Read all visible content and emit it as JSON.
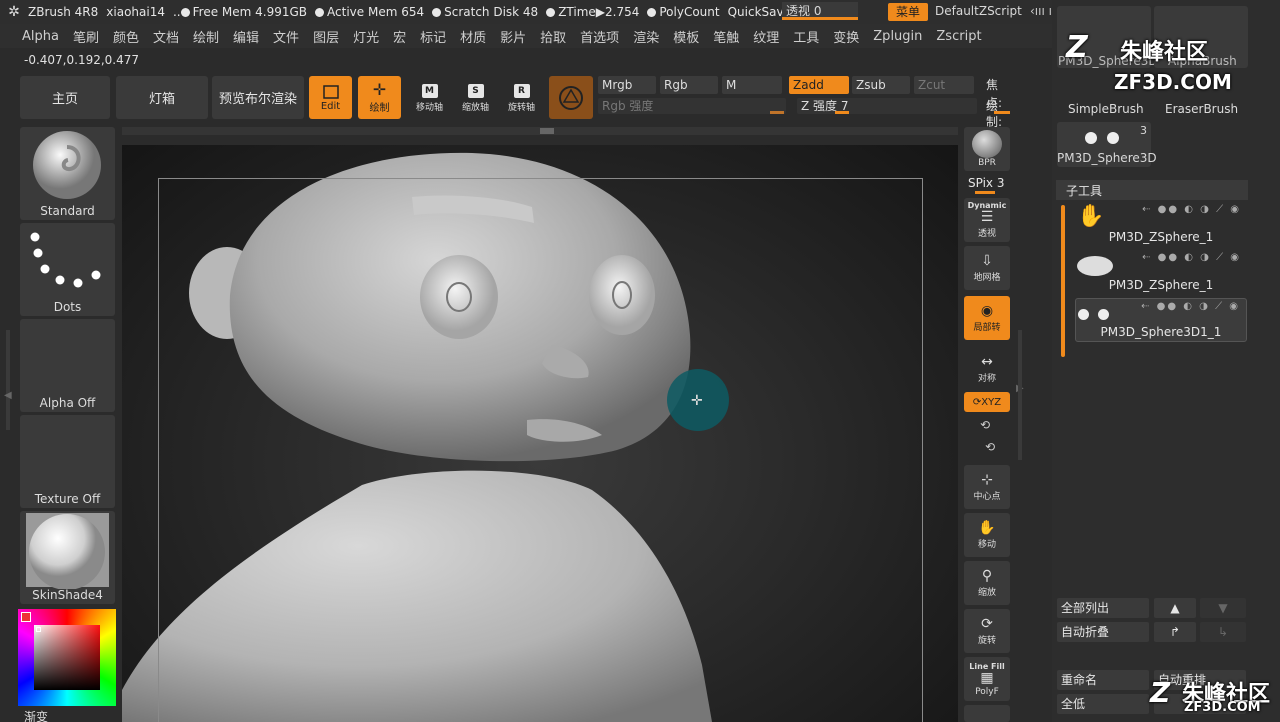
{
  "titlebar": {
    "app": "ZBrush 4R8",
    "user": "xiaohai14",
    "free_mem": "Free Mem 4.991GB",
    "active_mem": "Active Mem 654",
    "scratch_disk": "Scratch Disk 48",
    "ztime": "ZTime▶2.754",
    "polycount": "PolyCount",
    "quicksave": "QuickSave",
    "toushi_label": "透视",
    "toushi_value": "0",
    "menu_label": "菜单",
    "default_zscript": "DefaultZScript"
  },
  "menubar": [
    "Alpha",
    "笔刷",
    "颜色",
    "文档",
    "绘制",
    "编辑",
    "文件",
    "图层",
    "灯光",
    "宏",
    "标记",
    "材质",
    "影片",
    "拾取",
    "首选项",
    "渲染",
    "模板",
    "笔触",
    "纹理",
    "工具",
    "变换",
    "Zplugin",
    "Zscript"
  ],
  "coords": "-0.407,0.192,0.477",
  "toolbar": {
    "home": "主页",
    "lightbox": "灯箱",
    "bool_preview": "预览布尔渲染",
    "edit": "Edit",
    "draw": "绘制",
    "move": "移动轴",
    "scale": "缩放轴",
    "rotate": "旋转轴",
    "mrgb": "Mrgb",
    "rgb": "Rgb",
    "m": "M",
    "zadd": "Zadd",
    "zsub": "Zsub",
    "zcut": "Zcut",
    "focal": "焦点:",
    "rgb_intensity": "Rgb 强度",
    "z_intensity_label": "Z 强度",
    "z_intensity_value": "7",
    "draw_size": "绘制:"
  },
  "left_panel": {
    "brush": "Standard",
    "stroke": "Dots",
    "alpha": "Alpha Off",
    "texture": "Texture Off",
    "material": "SkinShade4",
    "gradient": "渐变"
  },
  "right_toolbar": {
    "bpr": "BPR",
    "spix_label": "SPix",
    "spix_value": "3",
    "dynamic": "Dynamic",
    "persp": "透视",
    "floor": "地网格",
    "local": "局部转",
    "sym": "对称",
    "xyz": "XYZ",
    "center": "中心点",
    "move": "移动",
    "zoom": "缩放",
    "rotate": "旋转",
    "linefill": "Line Fill",
    "polyf": "PolyF"
  },
  "right_panel": {
    "brush_items": [
      {
        "label": "PM3D_Sphere3D"
      },
      {
        "label": "AlphaBrush"
      },
      {
        "label": "SimpleBrush"
      },
      {
        "label": "EraserBrush"
      },
      {
        "label": "PM3D_Sphere3D"
      }
    ],
    "sphere_count": "3",
    "subtool_title": "子工具",
    "subtools": [
      {
        "name": "PM3D_ZSphere_1"
      },
      {
        "name": "PM3D_ZSphere_1"
      },
      {
        "name": "PM3D_Sphere3D1_1"
      }
    ],
    "list_all": "全部列出",
    "auto_collapse": "自动折叠",
    "rename": "重命名",
    "auto_reorder": "自动重排",
    "all_low": "全低"
  },
  "watermark": {
    "brand_cn": "朱峰社区",
    "brand_url": "ZF3D.COM"
  },
  "colors": {
    "accent": "#f08a1c",
    "panel": "#3a3a3a",
    "background": "#2b2b2b"
  }
}
